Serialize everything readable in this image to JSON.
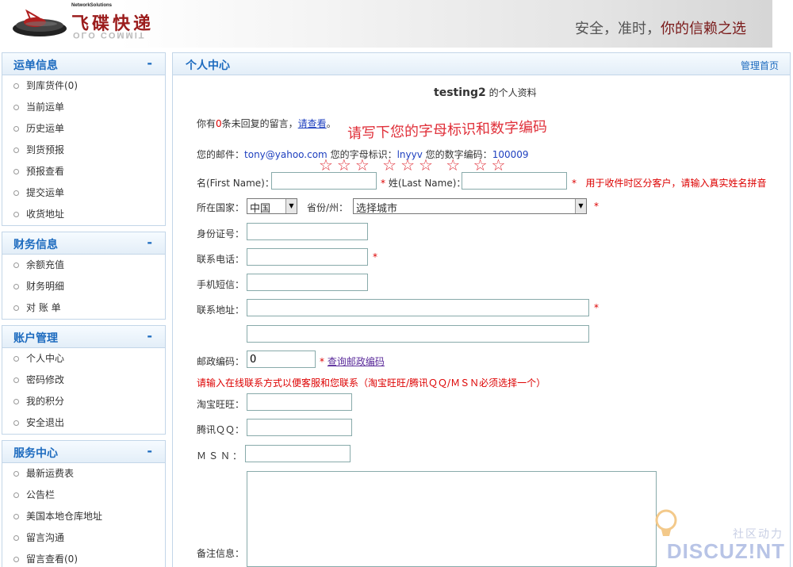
{
  "header": {
    "logo_small": "NetworkSolutions",
    "logo_cn": "飞碟快递",
    "logo_reflection": "OLO COMMIT",
    "slogan_part1": "安全，准时，",
    "slogan_part2": "你的信赖之选"
  },
  "sidebar": [
    {
      "title": "运单信息",
      "toggle": "-",
      "items": [
        {
          "label": "到库货件(0)"
        },
        {
          "label": "当前运单"
        },
        {
          "label": "历史运单"
        },
        {
          "label": "到货预报"
        },
        {
          "label": "预报查看"
        },
        {
          "label": "提交运单"
        },
        {
          "label": "收货地址"
        }
      ]
    },
    {
      "title": "财务信息",
      "toggle": "-",
      "items": [
        {
          "label": "余额充值"
        },
        {
          "label": "财务明细"
        },
        {
          "label": "对 账 单"
        }
      ]
    },
    {
      "title": "账户管理",
      "toggle": "-",
      "items": [
        {
          "label": "个人中心"
        },
        {
          "label": "密码修改"
        },
        {
          "label": "我的积分"
        },
        {
          "label": "安全退出"
        }
      ]
    },
    {
      "title": "服务中心",
      "toggle": "-",
      "items": [
        {
          "label": "最新运费表"
        },
        {
          "label": "公告栏"
        },
        {
          "label": "美国本地仓库地址"
        },
        {
          "label": "留言沟通"
        },
        {
          "label": "留言查看(0)"
        }
      ]
    }
  ],
  "main": {
    "title": "个人中心",
    "home_link": "管理首页",
    "profile_user": "testing2",
    "profile_suffix": "的个人资料",
    "msg_prefix": "你有",
    "msg_count": "0",
    "msg_mid": "条未回复的留言，",
    "msg_link": "请查看",
    "msg_end": "。",
    "annotation": "请写下您的字母标识和数字编码",
    "annotation_stars": "☆☆☆ ☆☆☆ ☆ ☆☆",
    "email_label": "您的邮件：",
    "email_value": "tony@yahoo.com",
    "letter_id_label": "您的字母标识：",
    "letter_id_value": "lnyyv",
    "num_id_label": "您的数字编码：",
    "num_id_value": "100009",
    "firstname_label": "名(First Name)：",
    "firstname_value": "",
    "lastname_label": "姓(Last Name)：",
    "lastname_value": "",
    "name_hint": "用于收件时区分客户，请输入真实姓名拼音",
    "req_mark": "*",
    "country_label": "所在国家：",
    "country_value": "中国",
    "province_label": "省份/州：",
    "province_value": "选择城市",
    "idcard_label": "身份证号：",
    "phone_label": "联系电话：",
    "mobile_label": "手机短信：",
    "address_label": "联系地址：",
    "zip_label": "邮政编码：",
    "zip_value": "0",
    "zip_link": "查询邮政编码",
    "contact_hint": "请输入在线联系方式以便客服和您联系（淘宝旺旺/腾讯ＱＱ/ＭＳＮ必须选择一个）",
    "taobao_label": "淘宝旺旺：",
    "qq_label": "腾讯ＱＱ：",
    "msn_label": "ＭＳＮ：",
    "remark_label": "备注信息："
  },
  "watermark": {
    "cn": "社区动力",
    "en": "DISCUZ!NT"
  },
  "colors": {
    "accent": "#1d6bbf",
    "required": "#dd0000",
    "brand": "#9b1c1c",
    "annotation": "#e0303a"
  }
}
